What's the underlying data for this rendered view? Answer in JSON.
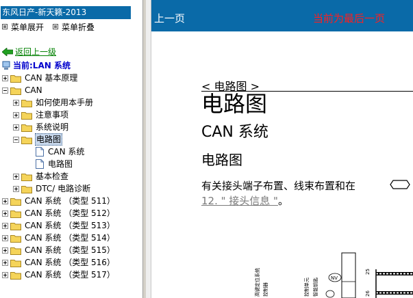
{
  "app": {
    "title": "东风日产-新天籁-2013"
  },
  "menu": {
    "expand_label": "菜单展开",
    "collapse_label": "菜单折叠"
  },
  "nav": {
    "back_label": "返回上一级",
    "current_label": "当前:LAN 系统"
  },
  "tree": {
    "can_basics": "CAN 基本原理",
    "can": "CAN",
    "how_to_use": "如何使用本手册",
    "precautions": "注意事项",
    "system_desc": "系统说明",
    "wiring_diagram": "电路图",
    "can_system": "CAN 系统",
    "wiring_doc": "电路图",
    "basic_inspection": "基本检查",
    "dtc_diag": "DTC/ 电路诊断",
    "types": [
      "CAN 系统 （类型 511）",
      "CAN 系统 （类型 512）",
      "CAN 系统 （类型 513）",
      "CAN 系统 （类型 514）",
      "CAN 系统 （类型 515）",
      "CAN 系统 （类型 516）",
      "CAN 系统 （类型 517）"
    ]
  },
  "doc": {
    "prev_label": "上一页",
    "last_page_msg": "当前为最后一页",
    "breadcrumb": "< 电路图 >",
    "title": "电路图",
    "subtitle": "CAN 系统",
    "section_heading": "电路图",
    "para_line1": "有关接头端子布置、线束布置和在",
    "para_link": "12. \" 接头信息 \"",
    "para_end": "。"
  },
  "diagram": {
    "vlabels": [
      "高键定位系统",
      "控制器",
      "控制单元",
      "智能钥匙"
    ],
    "nv_label": "NV",
    "pin_top": "25",
    "pin_bottom": "26"
  },
  "colors": {
    "header_blue": "#0a6aa8",
    "warning_red": "#ff1e1e",
    "link_green": "#008000",
    "current_blue": "#0000cc"
  }
}
